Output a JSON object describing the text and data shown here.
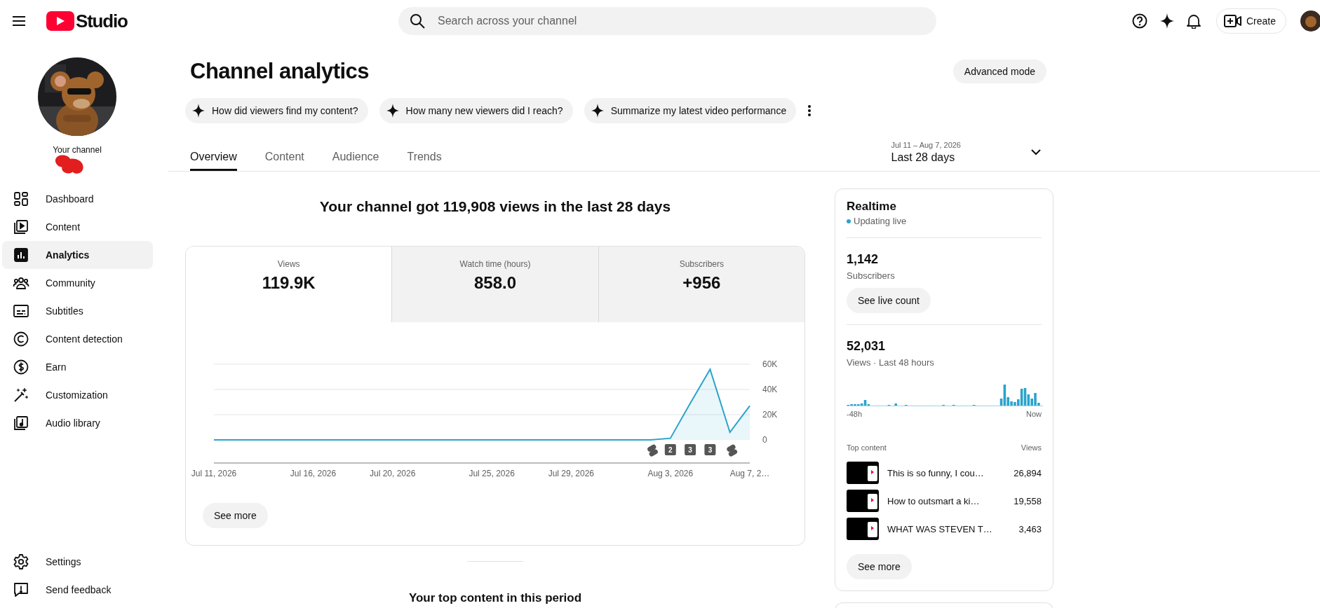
{
  "header": {
    "logo_text": "Studio",
    "search": {
      "placeholder": "Search across your channel"
    },
    "create_button": "Create"
  },
  "sidebar": {
    "channel_label": "Your channel",
    "items": [
      {
        "label": "Dashboard",
        "selected": false
      },
      {
        "label": "Content",
        "selected": false
      },
      {
        "label": "Analytics",
        "selected": true
      },
      {
        "label": "Community",
        "selected": false
      },
      {
        "label": "Subtitles",
        "selected": false
      },
      {
        "label": "Content detection",
        "selected": false
      },
      {
        "label": "Earn",
        "selected": false
      },
      {
        "label": "Customization",
        "selected": false
      },
      {
        "label": "Audio library",
        "selected": false
      }
    ],
    "footer_items": [
      {
        "label": "Settings"
      },
      {
        "label": "Send feedback"
      }
    ]
  },
  "page": {
    "title": "Channel analytics",
    "advanced_button": "Advanced mode",
    "suggestions": [
      "How did viewers find my content?",
      "How many new viewers did I reach?",
      "Summarize my latest video performance"
    ],
    "tabs": [
      {
        "label": "Overview",
        "selected": true
      },
      {
        "label": "Content",
        "selected": false
      },
      {
        "label": "Audience",
        "selected": false
      },
      {
        "label": "Trends",
        "selected": false
      }
    ],
    "date_range": {
      "range": "Jul 11 – Aug 7, 2026",
      "label": "Last 28 days"
    }
  },
  "summary": "Your channel got 119,908 views in the last 28 days",
  "metrics": [
    {
      "label": "Views",
      "value": "119.9K",
      "selected": true
    },
    {
      "label": "Watch time (hours)",
      "value": "858.0",
      "selected": false
    },
    {
      "label": "Subscribers",
      "value": "+956",
      "selected": false
    }
  ],
  "chart": {
    "chart_data": {
      "type": "area",
      "categories": [
        "Jul 11, 2026",
        null,
        null,
        null,
        null,
        "Jul 16, 2026",
        null,
        null,
        null,
        "Jul 20, 2026",
        null,
        null,
        null,
        null,
        "Jul 25, 2026",
        null,
        null,
        null,
        "Jul 29, 2026",
        null,
        null,
        null,
        null,
        "Aug 3, 2026",
        null,
        null,
        null,
        "Aug 7, 2…"
      ],
      "series": [
        {
          "color": "#2ba3cc",
          "values": [
            0,
            0,
            0,
            0,
            0,
            0,
            0,
            0,
            0,
            0,
            0,
            0,
            0,
            0,
            0,
            0,
            0,
            0,
            0,
            0,
            0,
            0,
            0,
            1300,
            29000,
            56000,
            6000,
            27000
          ]
        }
      ],
      "ylim": [
        0,
        60000
      ],
      "yticks": [
        {
          "value": 0,
          "label": "0"
        },
        {
          "value": 20000,
          "label": "20K"
        },
        {
          "value": 40000,
          "label": "40K"
        },
        {
          "value": 60000,
          "label": "60K"
        }
      ]
    },
    "markers": [
      {
        "kind": "shorts"
      },
      {
        "kind": "count",
        "text": "2"
      },
      {
        "kind": "count",
        "text": "3"
      },
      {
        "kind": "count",
        "text": "3"
      },
      {
        "kind": "shorts"
      }
    ],
    "see_more": "See more"
  },
  "top_content_heading": "Your top content in this period",
  "realtime": {
    "title": "Realtime",
    "status": "Updating live",
    "subscribers": "1,142",
    "subscribers_label": "Subscribers",
    "live_button": "See live count",
    "views": "52,031",
    "views_label": "Views · Last 48 hours",
    "axis_start": "-48h",
    "axis_end": "Now",
    "top_heading": "Top content",
    "views_heading": "Views",
    "top": [
      {
        "title": "This is so funny, I cou…",
        "views": "26,894"
      },
      {
        "title": "How to outsmart a ki…",
        "views": "19,558"
      },
      {
        "title": "WHAT WAS STEVEN T…",
        "views": "3,463"
      }
    ],
    "see_more": "See more"
  }
}
